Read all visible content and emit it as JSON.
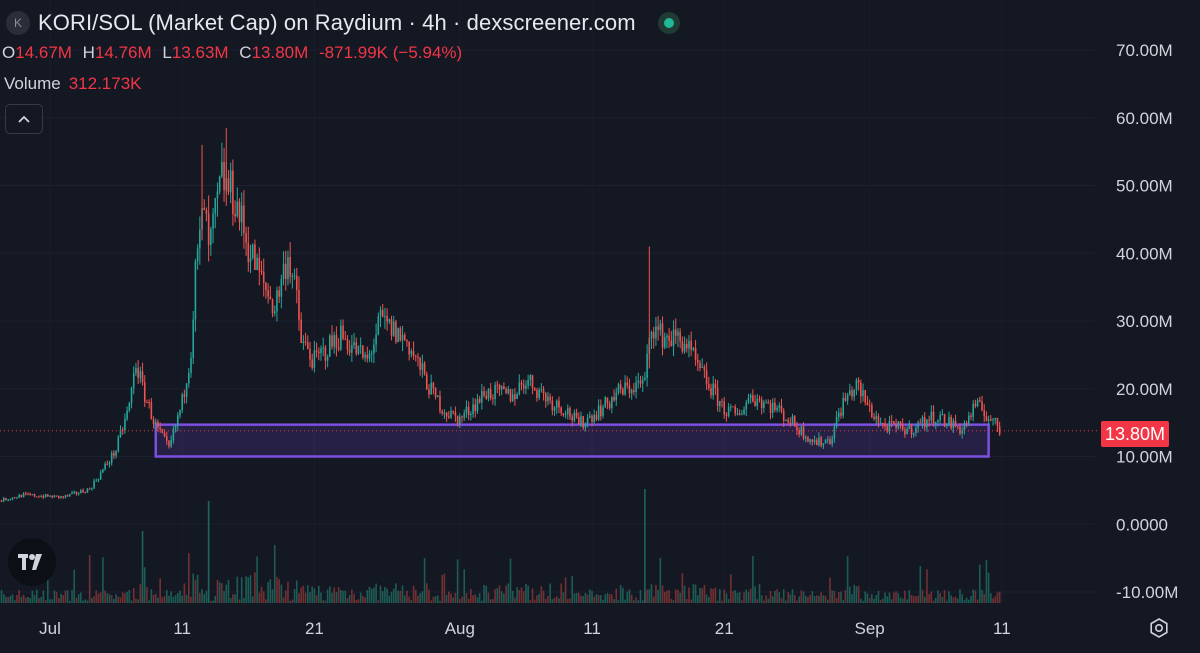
{
  "header": {
    "symbol_icon": "K",
    "title": "KORI/SOL (Market Cap) on Raydium · 4h · dexscreener.com",
    "status_icon": "live-status-dot-icon"
  },
  "ohlc": {
    "o_label": "O",
    "o_value": "14.67M",
    "h_label": "H",
    "h_value": "14.76M",
    "l_label": "L",
    "l_value": "13.63M",
    "c_label": "C",
    "c_value": "13.80M",
    "change": "-871.99K (−5.94%)"
  },
  "volume": {
    "label": "Volume",
    "value": "312.173K"
  },
  "controls": {
    "collapse_icon": "chevron-up-icon",
    "settings_icon": "gear-icon",
    "logo_icon": "tradingview-logo-icon"
  },
  "colors": {
    "background": "#141823",
    "up": "#26a69a",
    "down": "#ef5350",
    "zone": "#7b4fe0",
    "last_price": "#f23645"
  },
  "chart_data": {
    "type": "candlestick",
    "interval": "4h",
    "y_axis": {
      "labels": [
        "70.00M",
        "60.00M",
        "50.00M",
        "40.00M",
        "30.00M",
        "20.00M",
        "10.00M",
        "0.0000",
        "-10.00M"
      ],
      "range": [
        -10000000,
        70000000
      ]
    },
    "x_axis": {
      "labels": [
        "Jul",
        "11",
        "21",
        "Aug",
        "11",
        "21",
        "Sep",
        "11"
      ]
    },
    "last_price": 13800000,
    "last_price_label": "13.80M",
    "support_zone": {
      "date_range": [
        "2024-07-09",
        "2024-09-10"
      ],
      "value_range": [
        10000000,
        14700000
      ]
    },
    "market_cap_path": [
      {
        "date": "2024-06-26",
        "value": 3000000
      },
      {
        "date": "2024-06-29",
        "value": 4300000
      },
      {
        "date": "2024-07-02",
        "value": 4000000
      },
      {
        "date": "2024-07-04",
        "value": 5200000
      },
      {
        "date": "2024-07-05",
        "value": 8000000
      },
      {
        "date": "2024-07-06",
        "value": 11000000
      },
      {
        "date": "2024-07-07",
        "value": 17500000
      },
      {
        "date": "2024-07-07T12:00",
        "value": 24000000
      },
      {
        "date": "2024-07-08",
        "value": 20000000
      },
      {
        "date": "2024-07-09",
        "value": 14500000
      },
      {
        "date": "2024-07-10",
        "value": 11000000
      },
      {
        "date": "2024-07-11",
        "value": 18000000
      },
      {
        "date": "2024-07-11T16:00",
        "value": 26000000
      },
      {
        "date": "2024-07-12",
        "value": 37000000
      },
      {
        "date": "2024-07-12T16:00",
        "value": 47000000
      },
      {
        "date": "2024-07-13",
        "value": 40000000
      },
      {
        "date": "2024-07-14",
        "value": 51000000
      },
      {
        "date": "2024-07-15",
        "value": 48000000
      },
      {
        "date": "2024-07-16",
        "value": 41000000
      },
      {
        "date": "2024-07-17",
        "value": 36000000
      },
      {
        "date": "2024-07-18",
        "value": 32000000
      },
      {
        "date": "2024-07-19",
        "value": 40000000
      },
      {
        "date": "2024-07-19T16:00",
        "value": 33000000
      },
      {
        "date": "2024-07-20",
        "value": 27000000
      },
      {
        "date": "2024-07-21",
        "value": 24000000
      },
      {
        "date": "2024-07-23",
        "value": 28000000
      },
      {
        "date": "2024-07-25",
        "value": 24000000
      },
      {
        "date": "2024-07-26",
        "value": 30000000
      },
      {
        "date": "2024-07-28",
        "value": 27000000
      },
      {
        "date": "2024-07-29",
        "value": 23000000
      },
      {
        "date": "2024-07-30",
        "value": 19000000
      },
      {
        "date": "2024-07-31",
        "value": 16500000
      },
      {
        "date": "2024-08-01",
        "value": 15500000
      },
      {
        "date": "2024-08-03",
        "value": 19500000
      },
      {
        "date": "2024-08-05",
        "value": 19000000
      },
      {
        "date": "2024-08-06",
        "value": 21500000
      },
      {
        "date": "2024-08-08",
        "value": 18000000
      },
      {
        "date": "2024-08-09",
        "value": 17000000
      },
      {
        "date": "2024-08-10",
        "value": 14700000
      },
      {
        "date": "2024-08-12",
        "value": 17500000
      },
      {
        "date": "2024-08-13",
        "value": 19500000
      },
      {
        "date": "2024-08-15",
        "value": 21000000
      },
      {
        "date": "2024-08-15T12:00",
        "value": 30000000
      },
      {
        "date": "2024-08-16",
        "value": 28000000
      },
      {
        "date": "2024-08-18",
        "value": 27000000
      },
      {
        "date": "2024-08-19",
        "value": 23000000
      },
      {
        "date": "2024-08-20",
        "value": 20000000
      },
      {
        "date": "2024-08-21",
        "value": 17000000
      },
      {
        "date": "2024-08-22",
        "value": 16000000
      },
      {
        "date": "2024-08-23",
        "value": 19000000
      },
      {
        "date": "2024-08-25",
        "value": 17000000
      },
      {
        "date": "2024-08-27",
        "value": 13500000
      },
      {
        "date": "2024-08-28",
        "value": 12000000
      },
      {
        "date": "2024-08-29",
        "value": 12500000
      },
      {
        "date": "2024-08-30",
        "value": 18000000
      },
      {
        "date": "2024-08-31",
        "value": 20500000
      },
      {
        "date": "2024-09-01",
        "value": 17000000
      },
      {
        "date": "2024-09-02",
        "value": 14500000
      },
      {
        "date": "2024-09-04",
        "value": 14000000
      },
      {
        "date": "2024-09-06",
        "value": 16000000
      },
      {
        "date": "2024-09-07",
        "value": 15000000
      },
      {
        "date": "2024-09-08",
        "value": 14000000
      },
      {
        "date": "2024-09-09",
        "value": 17500000
      },
      {
        "date": "2024-09-10",
        "value": 16000000
      },
      {
        "date": "2024-09-10T20:00",
        "value": 13800000
      }
    ],
    "volume_spikes": [
      {
        "date": "2024-07-08",
        "value": 1.2
      },
      {
        "date": "2024-07-13",
        "value": 1.7
      },
      {
        "date": "2024-08-15",
        "value": 1.9
      }
    ]
  }
}
